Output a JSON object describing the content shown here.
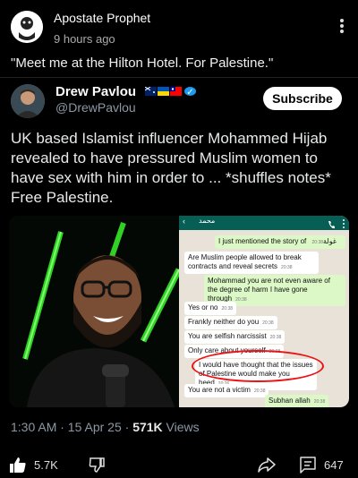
{
  "post": {
    "author": "Apostate Prophet",
    "time": "9 hours ago",
    "text": "\"Meet me at the Hilton Hotel. For Palestine.\""
  },
  "tweet": {
    "name": "Drew Pavlou",
    "handle": "@DrewPavlou",
    "subscribe_label": "Subscribe",
    "body": "UK based Islamist influencer Mohammed Hijab revealed to have pressured Muslim women to have sex with him in order to ... *shuffles notes* Free Palestine.",
    "time": "1:30 AM · 15 Apr 25 · ",
    "views_count": "571K",
    "views_label": " Views"
  },
  "chat": {
    "title": "محمد",
    "messages": [
      {
        "text": "I just mentioned the story of غولة",
        "time": "20:38",
        "side": "out"
      },
      {
        "text": "Are Muslim people allowed to break contracts and reveal secrets",
        "time": "20:38",
        "side": "in"
      },
      {
        "text": "Mohammad you are not even aware of the degree of harm I have gone through",
        "time": "20:38",
        "side": "out"
      },
      {
        "text": "Yes or no",
        "time": "20:38",
        "side": "in"
      },
      {
        "text": "Frankly neither do you",
        "time": "20:38",
        "side": "in"
      },
      {
        "text": "You are selfish narcissist",
        "time": "20:38",
        "side": "in"
      },
      {
        "text": "Only care about yourself",
        "time": "20:38",
        "side": "in"
      },
      {
        "text": "I would have thought that the issues of Palestine would make you heed",
        "time": "20:26",
        "side": "in"
      },
      {
        "text": "You are not a victim",
        "time": "20:38",
        "side": "in"
      },
      {
        "text": "Subhan allah",
        "time": "20:38",
        "side": "out"
      }
    ]
  },
  "actions": {
    "likes": "5.7K",
    "comments": "647"
  },
  "icons": {
    "more": "more-vertical-icon",
    "like": "thumbs-up-icon",
    "dislike": "thumbs-down-icon",
    "share": "share-icon",
    "comment": "comment-icon",
    "verified": "verified-badge-icon"
  },
  "colors": {
    "background": "#000000",
    "verified": "#1d9bf0",
    "meta": "#8b98a5",
    "chat_header": "#075e54",
    "highlight_ring": "#ee1111"
  }
}
